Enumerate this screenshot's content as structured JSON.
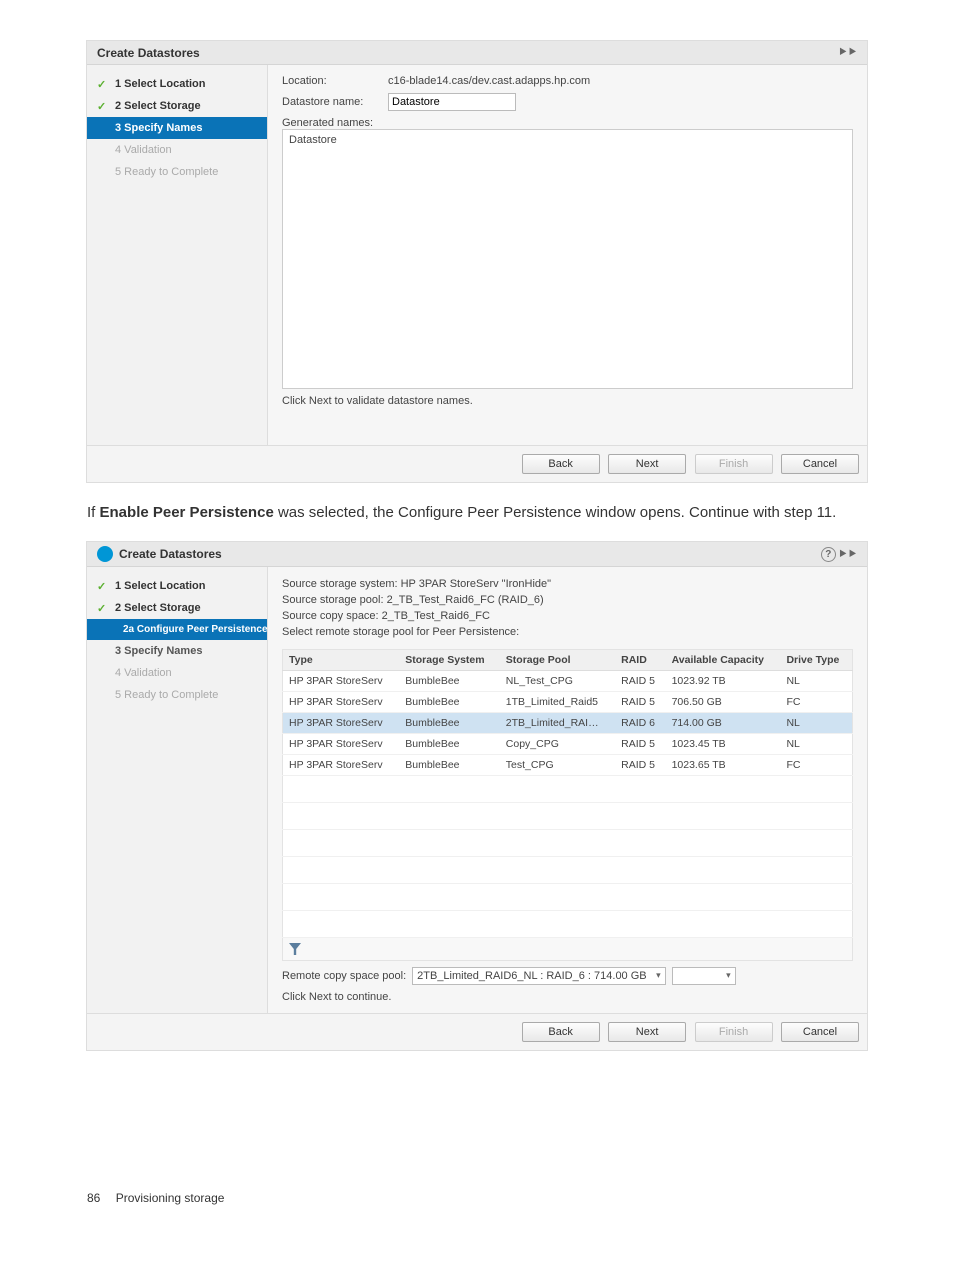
{
  "dialog1": {
    "title": "Create Datastores",
    "steps": {
      "s1": "1 Select Location",
      "s2": "2 Select Storage",
      "s3": "3 Specify Names",
      "s4": "4 Validation",
      "s5": "5 Ready to Complete"
    },
    "location_label": "Location:",
    "location_value": "c16-blade14.cas/dev.cast.adapps.hp.com",
    "dsname_label": "Datastore name:",
    "dsname_value": "Datastore",
    "generated_label": "Generated names:",
    "generated_item": "Datastore",
    "hint": "Click Next to validate datastore names.",
    "buttons": {
      "back": "Back",
      "next": "Next",
      "finish": "Finish",
      "cancel": "Cancel"
    }
  },
  "paragraph": {
    "prefix": "If ",
    "bold": "Enable Peer Persistence",
    "rest": " was selected, the Configure Peer Persistence window opens. Continue with step 11."
  },
  "dialog2": {
    "title": "Create Datastores",
    "steps": {
      "s1": "1 Select Location",
      "s2": "2 Select Storage",
      "s2a": "2a Configure Peer Persistence",
      "s3": "3 Specify Names",
      "s4": "4 Validation",
      "s5": "5 Ready to Complete"
    },
    "src_line1": "Source storage system: HP 3PAR StoreServ \"IronHide\"",
    "src_line2": "Source storage pool: 2_TB_Test_Raid6_FC (RAID_6)",
    "src_line3": "Source copy space: 2_TB_Test_Raid6_FC",
    "src_line4": "Select remote storage pool for Peer Persistence:",
    "headers": {
      "type": "Type",
      "system": "Storage System",
      "pool": "Storage Pool",
      "raid": "RAID",
      "cap": "Available Capacity",
      "drive": "Drive Type"
    },
    "rows": [
      {
        "type": "HP 3PAR StoreServ",
        "system": "BumbleBee",
        "pool": "NL_Test_CPG",
        "raid": "RAID 5",
        "cap": "1023.92 TB",
        "drive": "NL"
      },
      {
        "type": "HP 3PAR StoreServ",
        "system": "BumbleBee",
        "pool": "1TB_Limited_Raid5",
        "raid": "RAID 5",
        "cap": "706.50 GB",
        "drive": "FC"
      },
      {
        "type": "HP 3PAR StoreServ",
        "system": "BumbleBee",
        "pool": "2TB_Limited_RAI…",
        "raid": "RAID 6",
        "cap": "714.00 GB",
        "drive": "NL",
        "selected": true
      },
      {
        "type": "HP 3PAR StoreServ",
        "system": "BumbleBee",
        "pool": "Copy_CPG",
        "raid": "RAID 5",
        "cap": "1023.45 TB",
        "drive": "NL"
      },
      {
        "type": "HP 3PAR StoreServ",
        "system": "BumbleBee",
        "pool": "Test_CPG",
        "raid": "RAID 5",
        "cap": "1023.65 TB",
        "drive": "FC"
      }
    ],
    "remote_label": "Remote copy space pool:",
    "remote_value": "2TB_Limited_RAID6_NL : RAID_6 : 714.00 GB",
    "hint": "Click Next to continue.",
    "buttons": {
      "back": "Back",
      "next": "Next",
      "finish": "Finish",
      "cancel": "Cancel"
    }
  },
  "footer": {
    "page": "86",
    "section": "Provisioning storage"
  }
}
